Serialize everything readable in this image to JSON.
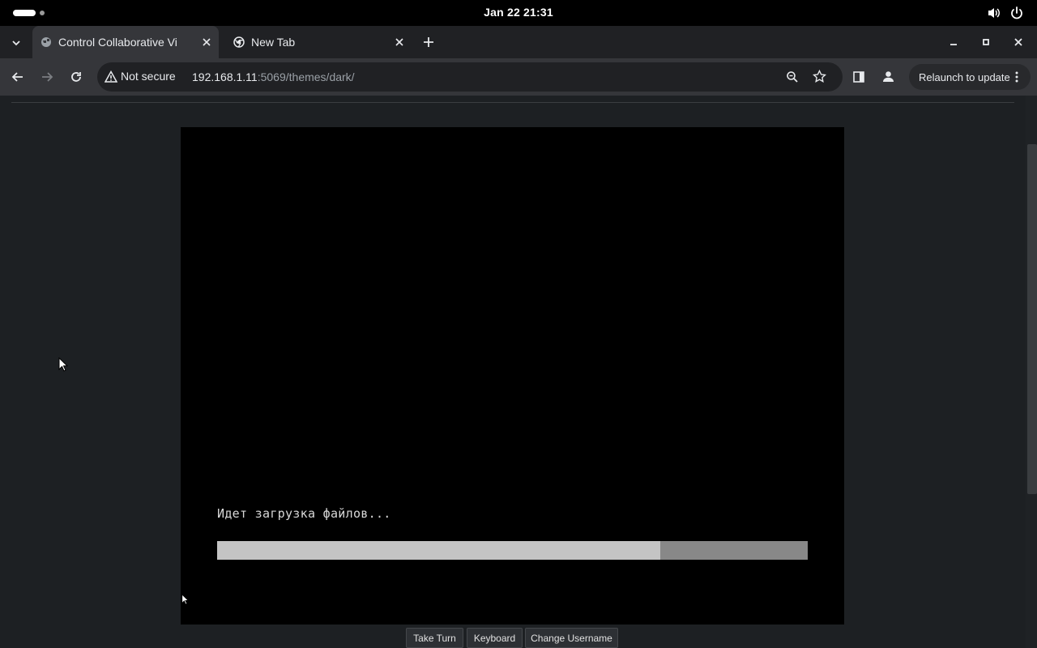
{
  "system_bar": {
    "clock": "Jan 22  21:31"
  },
  "tabs": [
    {
      "title": "Control Collaborative Vi",
      "active": true
    },
    {
      "title": "New Tab",
      "active": false
    }
  ],
  "toolbar": {
    "security_label": "Not secure",
    "url_host": "192.168.1.11",
    "url_rest": ":5069/themes/dark/",
    "relaunch_label": "Relaunch to update"
  },
  "vm": {
    "status_text": "Идет загрузка файлов...",
    "progress_fraction": 0.75
  },
  "controls": {
    "take_turn": "Take Turn",
    "keyboard": "Keyboard",
    "change_username": "Change Username"
  },
  "colors": {
    "chrome_bg": "#202124",
    "toolbar_bg": "#35363a",
    "page_bg": "#1d2023",
    "vm_bg": "#000000"
  }
}
